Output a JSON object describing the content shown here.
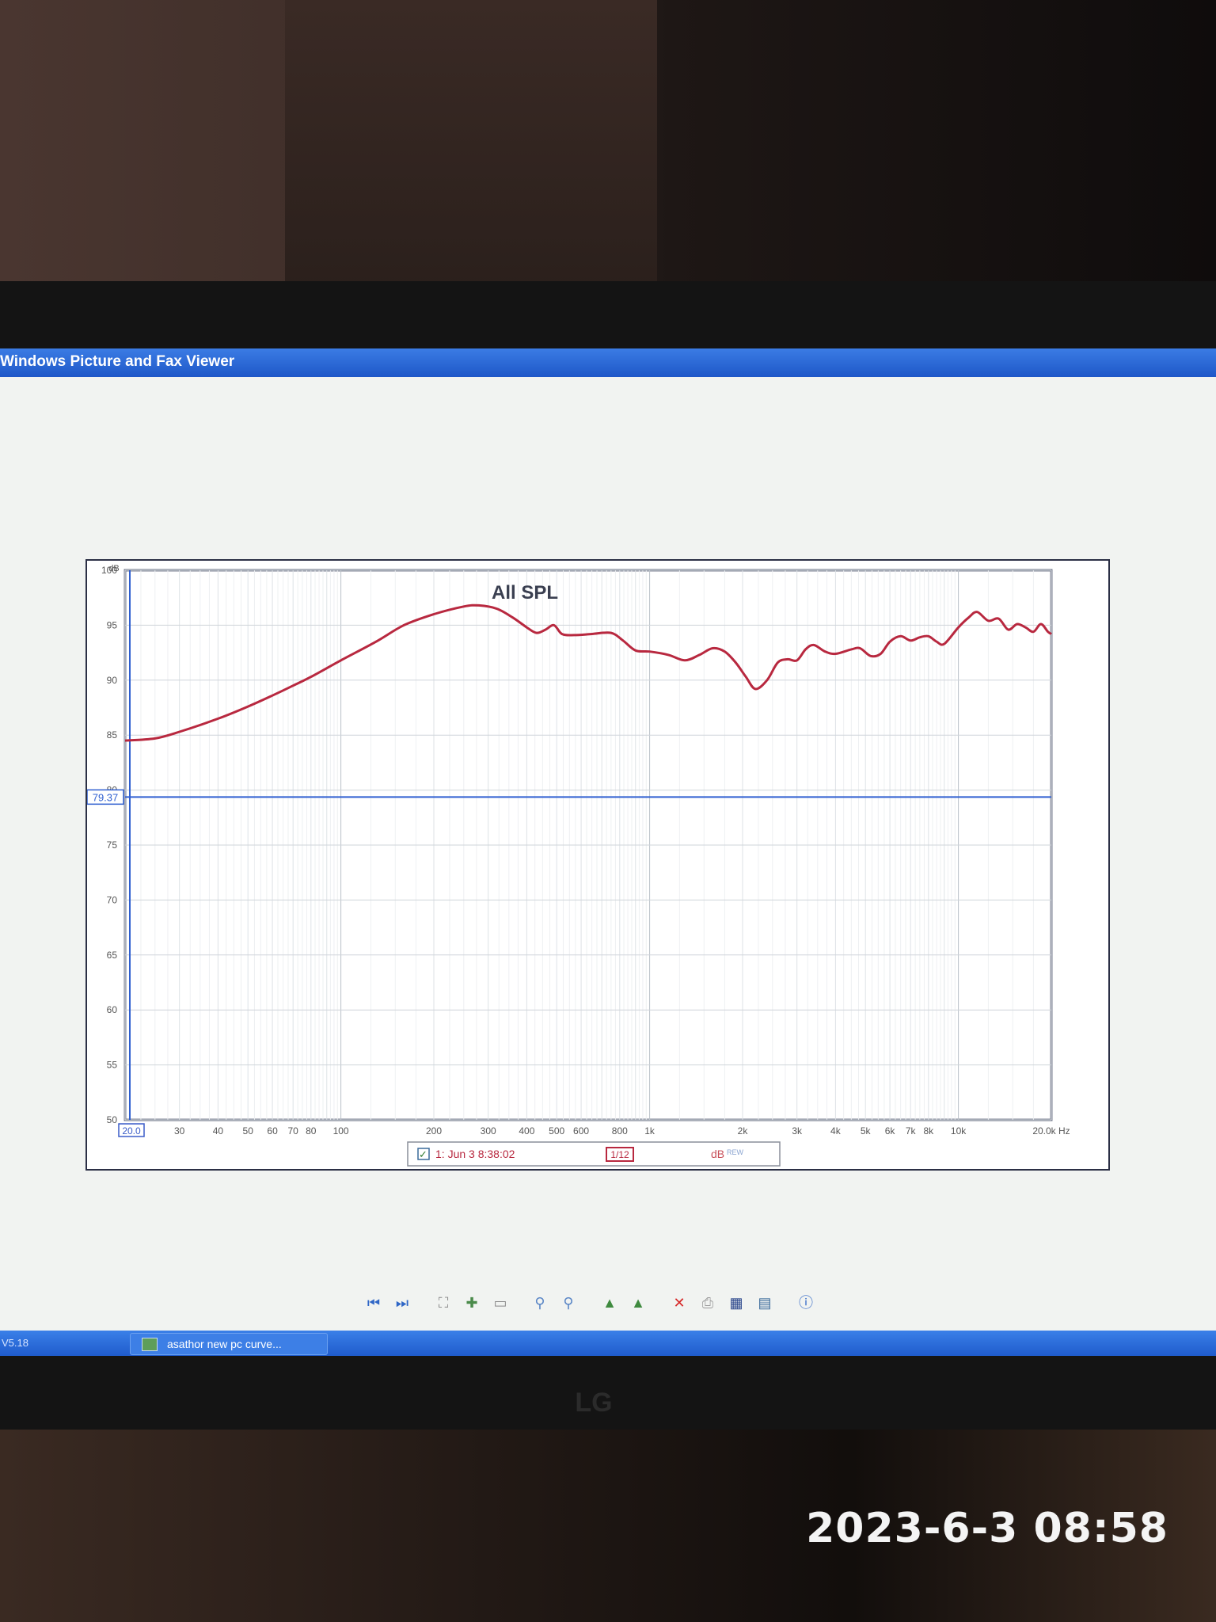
{
  "window": {
    "title": "Windows Picture and Fax Viewer"
  },
  "chart_data": {
    "type": "line",
    "title": "All SPL",
    "ylabel": "dB",
    "xlabel": "",
    "x_scale": "log",
    "xlim": [
      20,
      20000
    ],
    "ylim": [
      50,
      100
    ],
    "x_unit": "Hz",
    "y_ticks": [
      "50",
      "55",
      "60",
      "65",
      "70",
      "75",
      "80",
      "85",
      "90",
      "95",
      "100"
    ],
    "x_ticks": [
      {
        "f": 30,
        "label": "30"
      },
      {
        "f": 40,
        "label": "40"
      },
      {
        "f": 50,
        "label": "50"
      },
      {
        "f": 60,
        "label": "60"
      },
      {
        "f": 70,
        "label": "70"
      },
      {
        "f": 80,
        "label": "80"
      },
      {
        "f": 100,
        "label": "100"
      },
      {
        "f": 200,
        "label": "200"
      },
      {
        "f": 300,
        "label": "300"
      },
      {
        "f": 400,
        "label": "400"
      },
      {
        "f": 500,
        "label": "500"
      },
      {
        "f": 600,
        "label": "600"
      },
      {
        "f": 800,
        "label": "800"
      },
      {
        "f": 1000,
        "label": "1k"
      },
      {
        "f": 2000,
        "label": "2k"
      },
      {
        "f": 3000,
        "label": "3k"
      },
      {
        "f": 4000,
        "label": "4k"
      },
      {
        "f": 5000,
        "label": "5k"
      },
      {
        "f": 6000,
        "label": "6k"
      },
      {
        "f": 7000,
        "label": "7k"
      },
      {
        "f": 8000,
        "label": "8k"
      },
      {
        "f": 10000,
        "label": "10k"
      },
      {
        "f": 20000,
        "label": "20.0k Hz"
      }
    ],
    "x_start_label": "20.0",
    "cursor_level": 79.37,
    "cursor_label": "79.37",
    "grid": true,
    "series": [
      {
        "name": "1: Jun 3 8:38:02",
        "color": "#b8283f",
        "points": [
          [
            20,
            84.5
          ],
          [
            25,
            84.7
          ],
          [
            30,
            85.3
          ],
          [
            40,
            86.5
          ],
          [
            50,
            87.6
          ],
          [
            60,
            88.6
          ],
          [
            70,
            89.5
          ],
          [
            80,
            90.3
          ],
          [
            100,
            91.8
          ],
          [
            130,
            93.5
          ],
          [
            160,
            95.0
          ],
          [
            200,
            96.0
          ],
          [
            250,
            96.7
          ],
          [
            280,
            96.8
          ],
          [
            320,
            96.5
          ],
          [
            360,
            95.7
          ],
          [
            400,
            94.8
          ],
          [
            430,
            94.3
          ],
          [
            460,
            94.6
          ],
          [
            490,
            95.0
          ],
          [
            520,
            94.2
          ],
          [
            570,
            94.1
          ],
          [
            650,
            94.2
          ],
          [
            750,
            94.3
          ],
          [
            820,
            93.6
          ],
          [
            900,
            92.7
          ],
          [
            1000,
            92.6
          ],
          [
            1150,
            92.3
          ],
          [
            1300,
            91.8
          ],
          [
            1450,
            92.3
          ],
          [
            1600,
            92.9
          ],
          [
            1750,
            92.6
          ],
          [
            1900,
            91.6
          ],
          [
            2050,
            90.3
          ],
          [
            2200,
            89.2
          ],
          [
            2400,
            90.0
          ],
          [
            2600,
            91.6
          ],
          [
            2800,
            91.9
          ],
          [
            3000,
            91.8
          ],
          [
            3200,
            92.8
          ],
          [
            3400,
            93.2
          ],
          [
            3700,
            92.6
          ],
          [
            4000,
            92.4
          ],
          [
            4500,
            92.8
          ],
          [
            4800,
            92.9
          ],
          [
            5200,
            92.2
          ],
          [
            5600,
            92.4
          ],
          [
            6000,
            93.5
          ],
          [
            6500,
            94.0
          ],
          [
            7000,
            93.6
          ],
          [
            7500,
            93.9
          ],
          [
            8000,
            94.0
          ],
          [
            8500,
            93.5
          ],
          [
            9000,
            93.3
          ],
          [
            10000,
            94.8
          ],
          [
            10800,
            95.7
          ],
          [
            11500,
            96.2
          ],
          [
            12500,
            95.4
          ],
          [
            13500,
            95.6
          ],
          [
            14500,
            94.6
          ],
          [
            15500,
            95.1
          ],
          [
            16500,
            94.8
          ],
          [
            17500,
            94.4
          ],
          [
            18500,
            95.1
          ],
          [
            19500,
            94.4
          ],
          [
            20000,
            94.2
          ]
        ]
      }
    ],
    "legend": {
      "series_label": "1: Jun 3 8:38:02",
      "smoothing": "1/12",
      "unit": "dB",
      "unit_sub": "REW"
    }
  },
  "statusbar": {
    "version": "V5.18"
  },
  "taskbar": {
    "task_label": "asathor new pc curve..."
  },
  "device": {
    "brand": "LG"
  },
  "photo": {
    "timestamp": "2023-6-3 08:58"
  },
  "toolbar": {
    "icons": [
      "prev-icon",
      "next-icon",
      "best-fit-icon",
      "actual-size-icon",
      "slideshow-icon",
      "zoom-in-icon",
      "zoom-out-icon",
      "rotate-cw-icon",
      "rotate-ccw-icon",
      "delete-icon",
      "print-icon",
      "save-icon",
      "open-with-icon",
      "help-icon"
    ]
  }
}
